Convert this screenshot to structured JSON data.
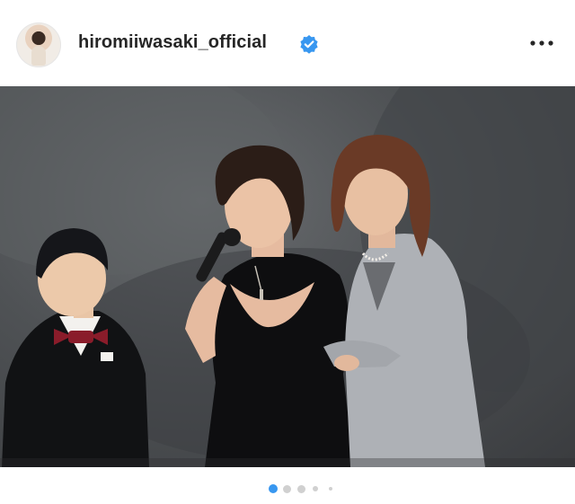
{
  "post": {
    "username": "hiromiiwasaki_official",
    "verified": true,
    "icons": {
      "avatar": "profile-avatar",
      "verified": "verified-badge-icon",
      "more": "more-options-icon"
    }
  },
  "carousel": {
    "total": 5,
    "active_index": 0,
    "active_color": "#3897f0",
    "inactive_color": "#d0d0d0"
  }
}
